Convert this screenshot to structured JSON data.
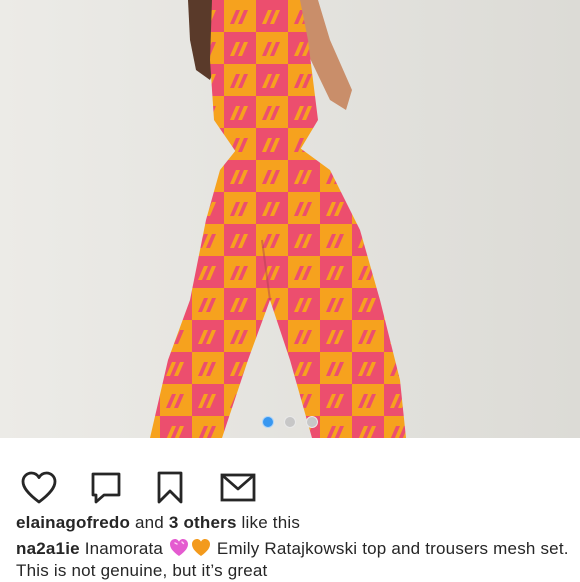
{
  "post": {
    "carousel": {
      "count": 3,
      "active_index": 0
    },
    "colors": {
      "accent": "#3897f0",
      "print_orange": "#f6a21e",
      "print_pink": "#ec4e6e",
      "wall": "#e7e6e2"
    }
  },
  "actions": [
    {
      "name": "like-button",
      "icon": "heart-icon"
    },
    {
      "name": "comment-button",
      "icon": "comment-icon"
    },
    {
      "name": "save-button",
      "icon": "bookmark-icon"
    },
    {
      "name": "share-button",
      "icon": "send-icon"
    }
  ],
  "likes": {
    "user": "elainagofredo",
    "and": " and ",
    "others": "3 others",
    "suffix": " like this"
  },
  "caption": {
    "user": "na2a1ie",
    "text_before": " Inamorata ",
    "emojis": [
      "pink-heart-icon",
      "orange-heart-icon"
    ],
    "text_after": " Emily Ratajkowski top and trousers mesh set. This is not genuine, but it’s great"
  }
}
